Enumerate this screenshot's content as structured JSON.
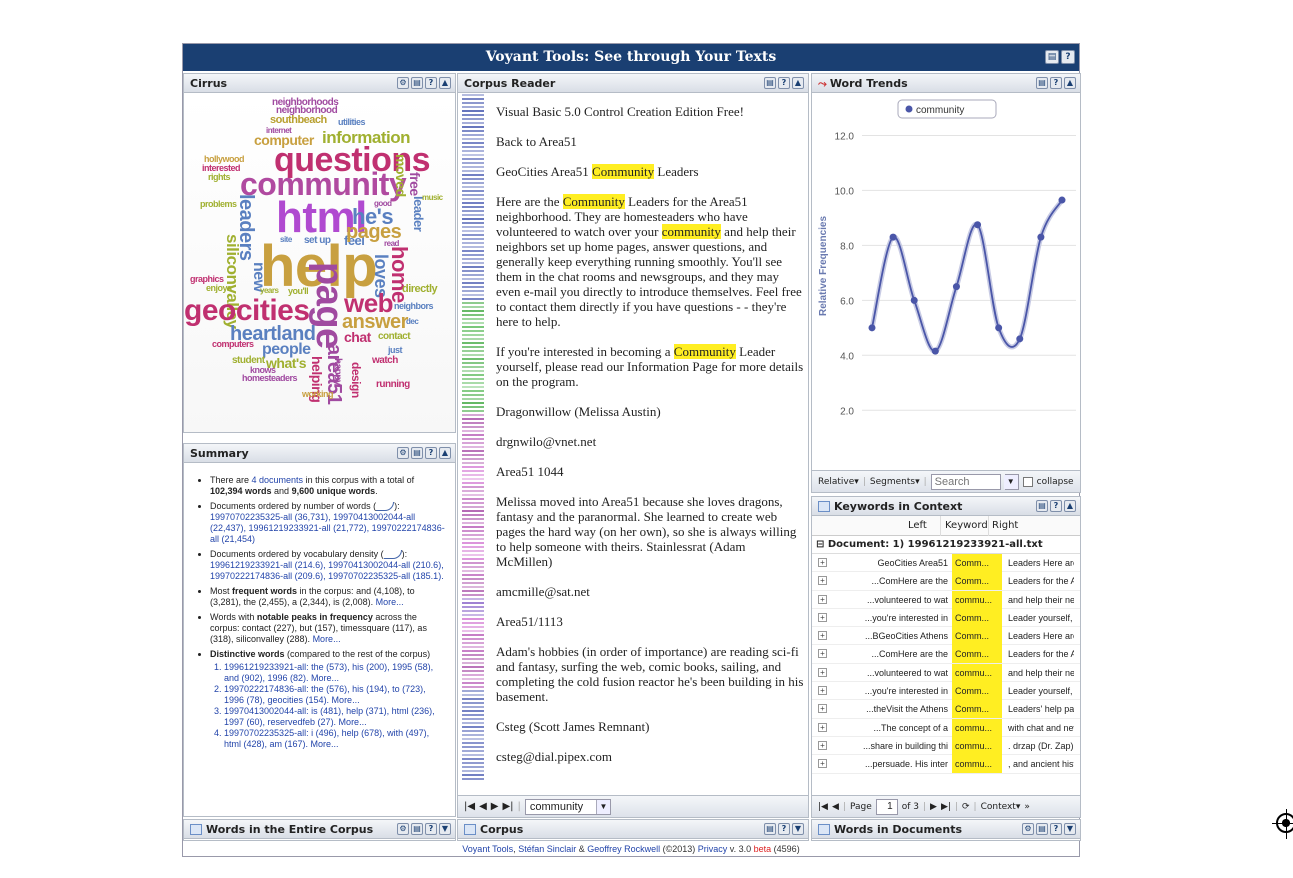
{
  "window": {
    "title": "Voyant Tools: See through Your Texts"
  },
  "panels": {
    "cirrus": "Cirrus",
    "summary": "Summary",
    "words_entire": "Words in the Entire Corpus",
    "reader": "Corpus Reader",
    "corpus": "Corpus",
    "trends": "Word Trends",
    "kwic": "Keywords in Context",
    "words_docs": "Words in Documents"
  },
  "cirrus_words": [
    {
      "t": "neighborhoods",
      "c": "#a04aa0"
    },
    {
      "t": "neighborhood",
      "c": "#a04aa0"
    },
    {
      "t": "southbeach",
      "c": "#b8a030"
    },
    {
      "t": "utilities",
      "c": "#5a80c0"
    },
    {
      "t": "internet",
      "c": "#a04aa0"
    },
    {
      "t": "computer",
      "c": "#c8a040"
    },
    {
      "t": "information",
      "c": "#a0b030"
    },
    {
      "t": "hollywood",
      "c": "#c8a040"
    },
    {
      "t": "questions",
      "c": "#c03070"
    },
    {
      "t": "interested",
      "c": "#c03070"
    },
    {
      "t": "rights",
      "c": "#a0b030"
    },
    {
      "t": "community",
      "c": "#b04aa0"
    },
    {
      "t": "moved",
      "c": "#a0b030"
    },
    {
      "t": "free",
      "c": "#a04aa0"
    },
    {
      "t": "leader",
      "c": "#5a80c0"
    },
    {
      "t": "music",
      "c": "#a0b030"
    },
    {
      "t": "problems",
      "c": "#a0b030"
    },
    {
      "t": "leaders",
      "c": "#5a80c0"
    },
    {
      "t": "html",
      "c": "#b04ad0"
    },
    {
      "t": "he's",
      "c": "#5a80c0"
    },
    {
      "t": "good",
      "c": "#a04aa0"
    },
    {
      "t": "site",
      "c": "#5a80c0"
    },
    {
      "t": "set up",
      "c": "#5a80c0"
    },
    {
      "t": "feel",
      "c": "#5a80c0"
    },
    {
      "t": "pages",
      "c": "#c8a040"
    },
    {
      "t": "read",
      "c": "#a04aa0"
    },
    {
      "t": "help",
      "c": "#c8a040"
    },
    {
      "t": "siliconvalley",
      "c": "#a0b030"
    },
    {
      "t": "new",
      "c": "#5a80c0"
    },
    {
      "t": "graphics",
      "c": "#c03070"
    },
    {
      "t": "enjoys",
      "c": "#a0b030"
    },
    {
      "t": "years",
      "c": "#a0b030"
    },
    {
      "t": "you'll",
      "c": "#a0b030"
    },
    {
      "t": "loves",
      "c": "#5a80c0"
    },
    {
      "t": "home",
      "c": "#c03070"
    },
    {
      "t": "directly",
      "c": "#a0b030"
    },
    {
      "t": "geocities",
      "c": "#c03070"
    },
    {
      "t": "page",
      "c": "#a04aa0"
    },
    {
      "t": "web",
      "c": "#c03070"
    },
    {
      "t": "neighbors",
      "c": "#5a80c0"
    },
    {
      "t": "answer",
      "c": "#c8a040"
    },
    {
      "t": "dec",
      "c": "#5a80c0"
    },
    {
      "t": "heartland",
      "c": "#5a80c0"
    },
    {
      "t": "chat",
      "c": "#c03070"
    },
    {
      "t": "contact",
      "c": "#a0b030"
    },
    {
      "t": "computers",
      "c": "#c03070"
    },
    {
      "t": "people",
      "c": "#5a80c0"
    },
    {
      "t": "just",
      "c": "#5a80c0"
    },
    {
      "t": "student",
      "c": "#a0b030"
    },
    {
      "t": "what's",
      "c": "#a0b030"
    },
    {
      "t": "area51",
      "c": "#a04aa0"
    },
    {
      "t": "watch",
      "c": "#c03070"
    },
    {
      "t": "knows",
      "c": "#a04aa0"
    },
    {
      "t": "homesteaders",
      "c": "#a04aa0"
    },
    {
      "t": "helping",
      "c": "#c03070"
    },
    {
      "t": "design",
      "c": "#c03070"
    },
    {
      "t": "running",
      "c": "#c03070"
    },
    {
      "t": "working",
      "c": "#c8a040"
    },
    {
      "t": "happy",
      "c": "#a04aa0"
    }
  ],
  "summary": {
    "intro_pre": "There are ",
    "intro_docs": "4 documents",
    "intro_mid": " in this corpus with a total of ",
    "intro_words": "102,394 words",
    "intro_and": " and ",
    "intro_unique": "9,600 unique words",
    "intro_end": ".",
    "by_words_label": "Documents ordered by number of words (",
    "by_words_close": "):",
    "by_words": "19970702235325-all (36,731), 19970413002044-all (22,437), 19961219233921-all (21,772), 19970222174836-all (21,454)",
    "by_density_label": "Documents ordered by vocabulary density (",
    "by_density_close": "):",
    "by_density": "19961219233921-all (214.6), 19970413002044-all (210.6), 19970222174836-all (209.6), 19970702235325-all (185.1).",
    "frequent_pre": "Most ",
    "frequent_bold": "frequent words",
    "frequent_mid": " in the corpus: ",
    "frequent": "and (4,108), to (3,281), the (2,455), a (2,344), is (2,008).",
    "frequent_more": "More...",
    "peaks_pre": "Words with ",
    "peaks_bold": "notable peaks in frequency",
    "peaks_mid": " across the corpus: ",
    "peaks": "contact (227), but (157), timessquare (117), as (318), siliconvalley (288).",
    "peaks_more": "More...",
    "distinctive_bold": "Distinctive words",
    "distinctive_rest": " (compared to the rest of the corpus)",
    "distinctive": [
      "19961219233921-all: the (573), his (200), 1995 (58), and (902), 1996 (82). More...",
      "19970222174836-all: the (576), his (194), to (723), 1996 (78), geocities (154). More...",
      "19970413002044-all: is (481), help (371), html (236), 1997 (60), reservedfeb (27). More...",
      "19970702235325-all: i (496), help (678), with (497), html (428), am (167). More..."
    ]
  },
  "reader": {
    "paragraphs": [
      "Visual Basic 5.0 Control Creation Edition Free!",
      "Back to Area51",
      "GeoCities Area51 Community Leaders",
      "Here are the Community Leaders for the Area51 neighborhood. They are homesteaders who have volunteered to watch over your community and help their neighbors set up home pages, answer questions, and generally keep everything running smoothly. You'll see them in the chat rooms and newsgroups, and they may even e-mail you directly to introduce themselves. Feel free to contact them directly if you have questions - - they're here to help.",
      "If you're interested in becoming a Community Leader yourself, please read our Information Page for more details on the program.",
      "Dragonwillow (Melissa Austin)",
      "drgnwilo@vnet.net",
      "Area51 1044",
      "Melissa moved into Area51 because she loves dragons, fantasy and the paranormal. She learned to create web pages the hard way (on her own), so she is always willing to help someone with theirs. Stainlessrat (Adam McMillen)",
      "amcmille@sat.net",
      "Area51/1113",
      "Adam's hobbies (in order of importance) are reading sci-fi and fantasy, surfing the web, comic books, sailing, and completing the cold fusion reactor he's been building in his basement.",
      "Csteg (Scott James Remnant)",
      "csteg@dial.pipex.com"
    ],
    "highlight_word": "community",
    "toolbar_word": "community"
  },
  "trends": {
    "legend": "community",
    "ylabel": "Relative Frequencies",
    "toolbar": {
      "relative": "Relative",
      "segments": "Segments",
      "search_placeholder": "Search",
      "collapse": "collapse"
    }
  },
  "chart_data": {
    "type": "line",
    "title": "",
    "xlabel": "",
    "ylabel": "Relative Frequencies",
    "ylim": [
      1.5,
      13
    ],
    "yticks": [
      2.0,
      4.0,
      6.0,
      8.0,
      10.0,
      12.0
    ],
    "series": [
      {
        "name": "community",
        "color": "#4a56a8",
        "values": [
          5.0,
          8.3,
          6.0,
          4.15,
          6.5,
          8.75,
          5.0,
          4.6,
          8.3,
          9.65
        ]
      }
    ]
  },
  "kwic": {
    "col_left": "Left",
    "col_keyword": "Keyword",
    "col_right": "Right",
    "doc": "Document: 1) 19961219233921-all.txt",
    "rows": [
      {
        "l": "GeoCities Area51",
        "k": "Comm...",
        "r": "Leaders Here are t..."
      },
      {
        "l": "...ComHere are the",
        "k": "Comm...",
        "r": "Leaders for the Ar..."
      },
      {
        "l": "...volunteered to wat",
        "k": "commu...",
        "r": "and help their neig..."
      },
      {
        "l": "...you're interested in",
        "k": "Comm...",
        "r": "Leader yourself, pl..."
      },
      {
        "l": "...BGeoCities Athens",
        "k": "Comm...",
        "r": "Leaders Here are t..."
      },
      {
        "l": "...ComHere are the",
        "k": "Comm...",
        "r": "Leaders for the At..."
      },
      {
        "l": "...volunteered to wat",
        "k": "commu...",
        "r": "and help their neig..."
      },
      {
        "l": "...you're interested in",
        "k": "Comm...",
        "r": "Leader yourself, pl..."
      },
      {
        "l": "...theVisit the Athens",
        "k": "Comm...",
        "r": "Leaders' help page..."
      },
      {
        "l": "...The concept of a",
        "k": "commu...",
        "r": "with chat and new..."
      },
      {
        "l": "...share in building thi",
        "k": "commu...",
        "r": ". drzap (Dr. Zap) d..."
      },
      {
        "l": "...persuade. His inter",
        "k": "commu...",
        "r": ", and ancient histor..."
      }
    ],
    "pager": {
      "page_label": "Page",
      "page": "1",
      "of": "of 3",
      "context": "Context"
    }
  },
  "footer": {
    "voyant": "Voyant Tools",
    "sep1": ", ",
    "sinclair": "Stéfan Sinclair",
    "amp": " & ",
    "rockwell": "Geoffrey Rockwell",
    "year": " (©2013) ",
    "privacy": "Privacy",
    "version": " v. 3.0 ",
    "beta": "beta",
    "build": " (4596)"
  },
  "colors": {
    "title_bg": "#1a3f72",
    "highlight": "#ffee22",
    "line": "#4a56a8",
    "link": "#2244aa"
  },
  "icons": [
    "gear-icon",
    "export-icon",
    "help-icon",
    "collapse-icon",
    "panel-icon",
    "first-page-icon",
    "prev-page-icon",
    "next-page-icon",
    "last-page-icon",
    "refresh-icon",
    "more-icon",
    "trend-icon"
  ]
}
